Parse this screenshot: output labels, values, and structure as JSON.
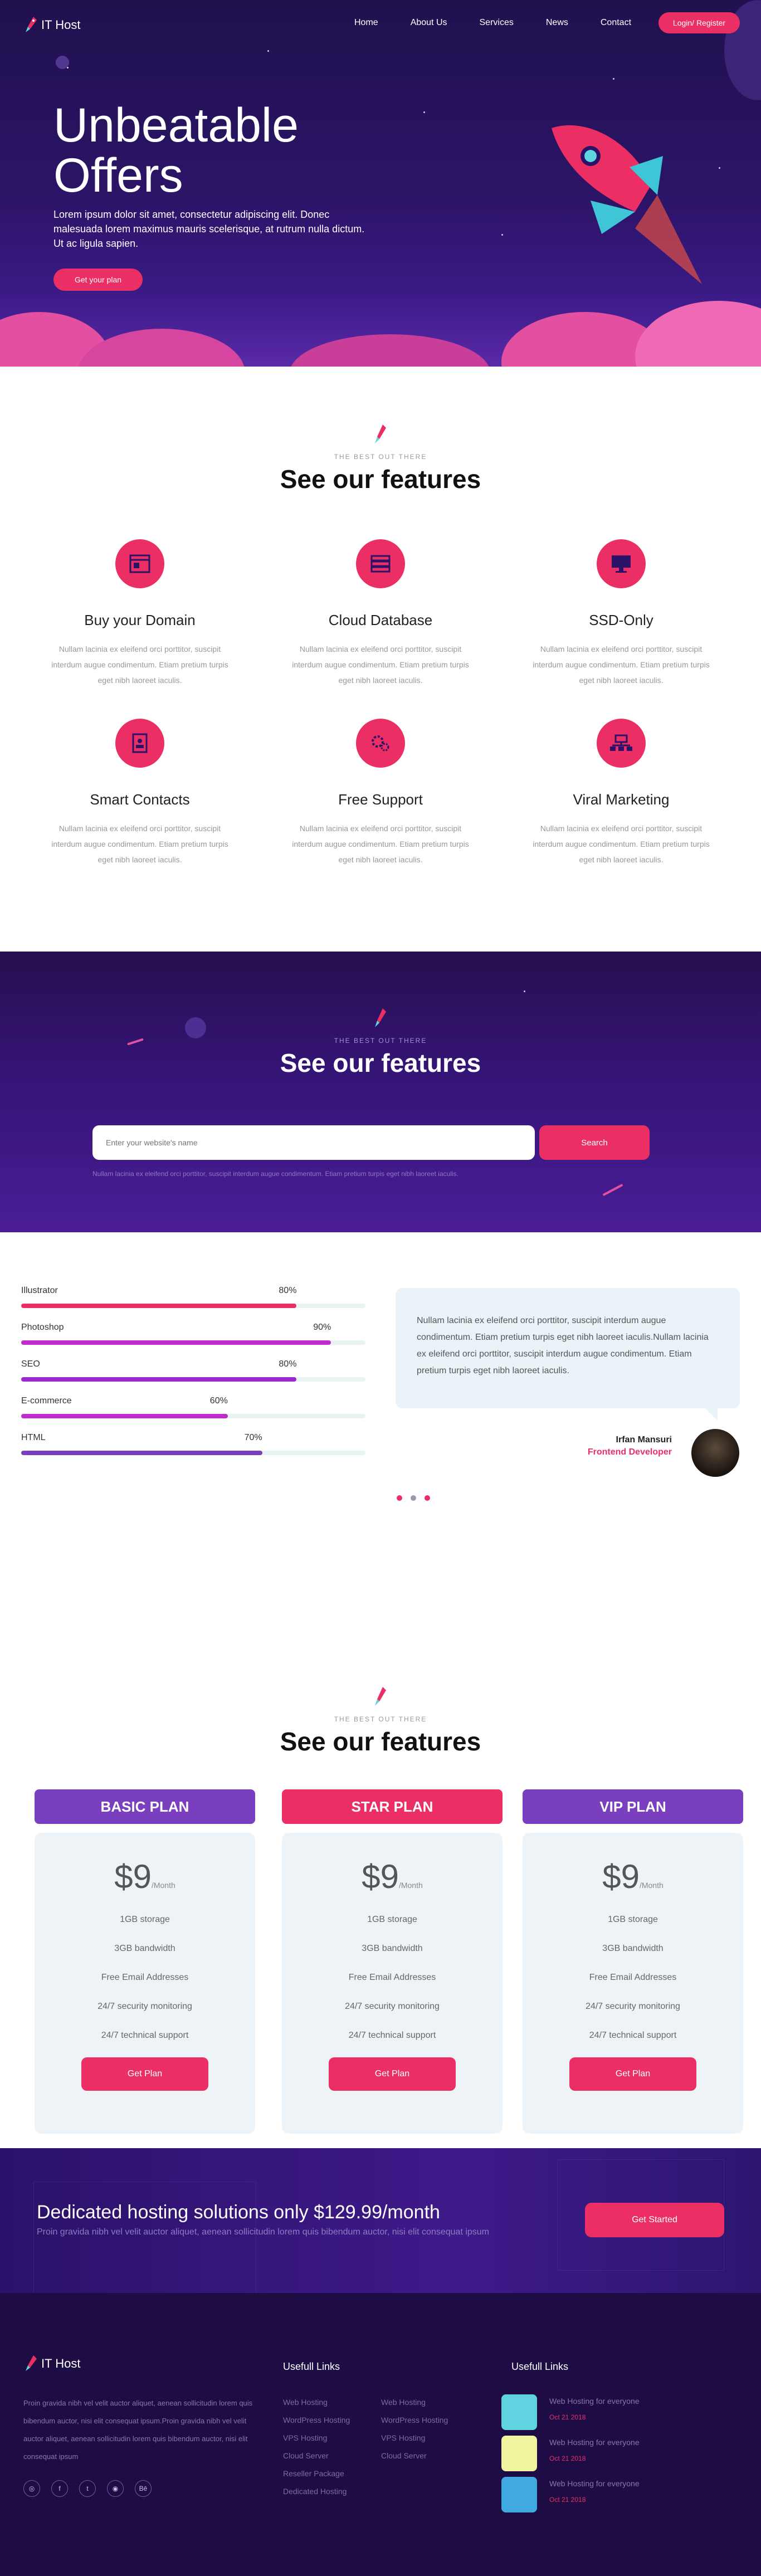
{
  "colors": {
    "accent": "#eb2f64",
    "purple": "#7a3fbf",
    "violet": "#c02bc9",
    "bg_dark": "#2a1268"
  },
  "nav": {
    "logo": "IT Host",
    "items": [
      "Home",
      "About Us",
      "Services",
      "News",
      "Contact"
    ],
    "login": "Login/ Register"
  },
  "hero": {
    "title_line1": "Unbeatable",
    "title_line2": "Offers",
    "text": "Lorem ipsum dolor sit amet, consectetur adipiscing elit. Donec malesuada lorem maximus mauris scelerisque, at rutrum nulla dictum. Ut ac ligula sapien.",
    "button": "Get your plan"
  },
  "features": {
    "subtitle": "THE BEST OUT THERE",
    "title": "See our features",
    "text": "Nullam lacinia ex eleifend orci porttitor, suscipit interdum augue condimentum. Etiam pretium turpis eget nibh laoreet iaculis.",
    "items": [
      {
        "name": "Buy your Domain",
        "icon": "browser-icon"
      },
      {
        "name": "Cloud Database",
        "icon": "server-icon"
      },
      {
        "name": "SSD-Only",
        "icon": "monitor-icon"
      },
      {
        "name": "Smart Contacts",
        "icon": "contact-book-icon"
      },
      {
        "name": "Free Support",
        "icon": "gears-icon"
      },
      {
        "name": "Viral Marketing",
        "icon": "network-icon"
      }
    ]
  },
  "domain": {
    "subtitle": "THE BEST OUT THERE",
    "title": "See our features",
    "placeholder": "Enter your website's name",
    "button": "Search",
    "note": "Nullam lacinia ex eleifend orci porttitor, suscipit interdum augue condimentum. Etiam pretium turpis eget nibh laoreet iaculis."
  },
  "skills": [
    {
      "label": "Illustrator",
      "pct": "80%",
      "value": 0.8,
      "color": "#eb2f64"
    },
    {
      "label": "Photoshop",
      "pct": "90%",
      "value": 0.9,
      "color": "#c02bc9"
    },
    {
      "label": "SEO",
      "pct": "80%",
      "value": 0.8,
      "color": "#9a2ad0"
    },
    {
      "label": "E-commerce",
      "pct": "60%",
      "value": 0.6,
      "color": "#c02bc9"
    },
    {
      "label": "HTML",
      "pct": "70%",
      "value": 0.7,
      "color": "#7a3fbf"
    }
  ],
  "testimonial": {
    "quote": "Nullam lacinia ex eleifend orci porttitor, suscipit interdum augue condimentum. Etiam pretium turpis eget nibh laoreet iaculis.Nullam lacinia ex eleifend orci porttitor, suscipit interdum augue condimentum. Etiam pretium turpis eget nibh laoreet iaculis.",
    "name": "Irfan Mansuri",
    "role": "Frontend Developer"
  },
  "pricing": {
    "subtitle": "THE BEST OUT THERE",
    "title": "See our features",
    "plans": [
      {
        "name": "BASIC PLAN",
        "color": "#7a3fbf",
        "price": "$9",
        "period": "/Month",
        "features": [
          "1GB storage",
          "3GB bandwidth",
          "Free Email Addresses",
          "24/7 security monitoring",
          "24/7 technical support"
        ],
        "button": "Get Plan"
      },
      {
        "name": "STAR PLAN",
        "color": "#eb2f64",
        "price": "$9",
        "period": "/Month",
        "features": [
          "1GB storage",
          "3GB bandwidth",
          "Free Email Addresses",
          "24/7 security monitoring",
          "24/7 technical support"
        ],
        "button": "Get Plan"
      },
      {
        "name": "VIP PLAN",
        "color": "#7a3fbf",
        "price": "$9",
        "period": "/Month",
        "features": [
          "1GB storage",
          "3GB bandwidth",
          "Free Email Addresses",
          "24/7 security monitoring",
          "24/7 technical support"
        ],
        "button": "Get Plan"
      }
    ]
  },
  "cta": {
    "title": "Dedicated hosting solutions only $129.99/month",
    "text": "Proin gravida nibh vel velit auctor aliquet, aenean sollicitudin lorem quis bibendum auctor, nisi elit consequat ipsum",
    "button": "Get Started"
  },
  "footer": {
    "logo": "IT Host",
    "text": "Proin gravida nibh vel velit auctor aliquet, aenean sollicitudin lorem quis bibendum auctor, nisi elit consequat ipsum.Proin gravida nibh vel velit auctor aliquet, aenean sollicitudin lorem quis bibendum auctor, nisi elit consequat ipsum",
    "social": [
      "dribbble-icon",
      "facebook-icon",
      "twitter-icon",
      "instagram-icon",
      "behance-icon"
    ],
    "links_title": "Usefull Links",
    "links_col1": [
      "Web Hosting",
      "WordPress Hosting",
      "VPS Hosting",
      "Cloud Server",
      "Reseller Package",
      "Dedicated Hosting"
    ],
    "links_col2": [
      "Web Hosting",
      "WordPress Hosting",
      "VPS Hosting",
      "Cloud Server"
    ],
    "news_title": "Usefull Links",
    "news": [
      {
        "title": "Web Hosting for everyone",
        "date": "Oct 21 2018"
      },
      {
        "title": "Web Hosting for everyone",
        "date": "Oct 21 2018"
      },
      {
        "title": "Web Hosting for everyone",
        "date": "Oct 21 2018"
      }
    ]
  }
}
